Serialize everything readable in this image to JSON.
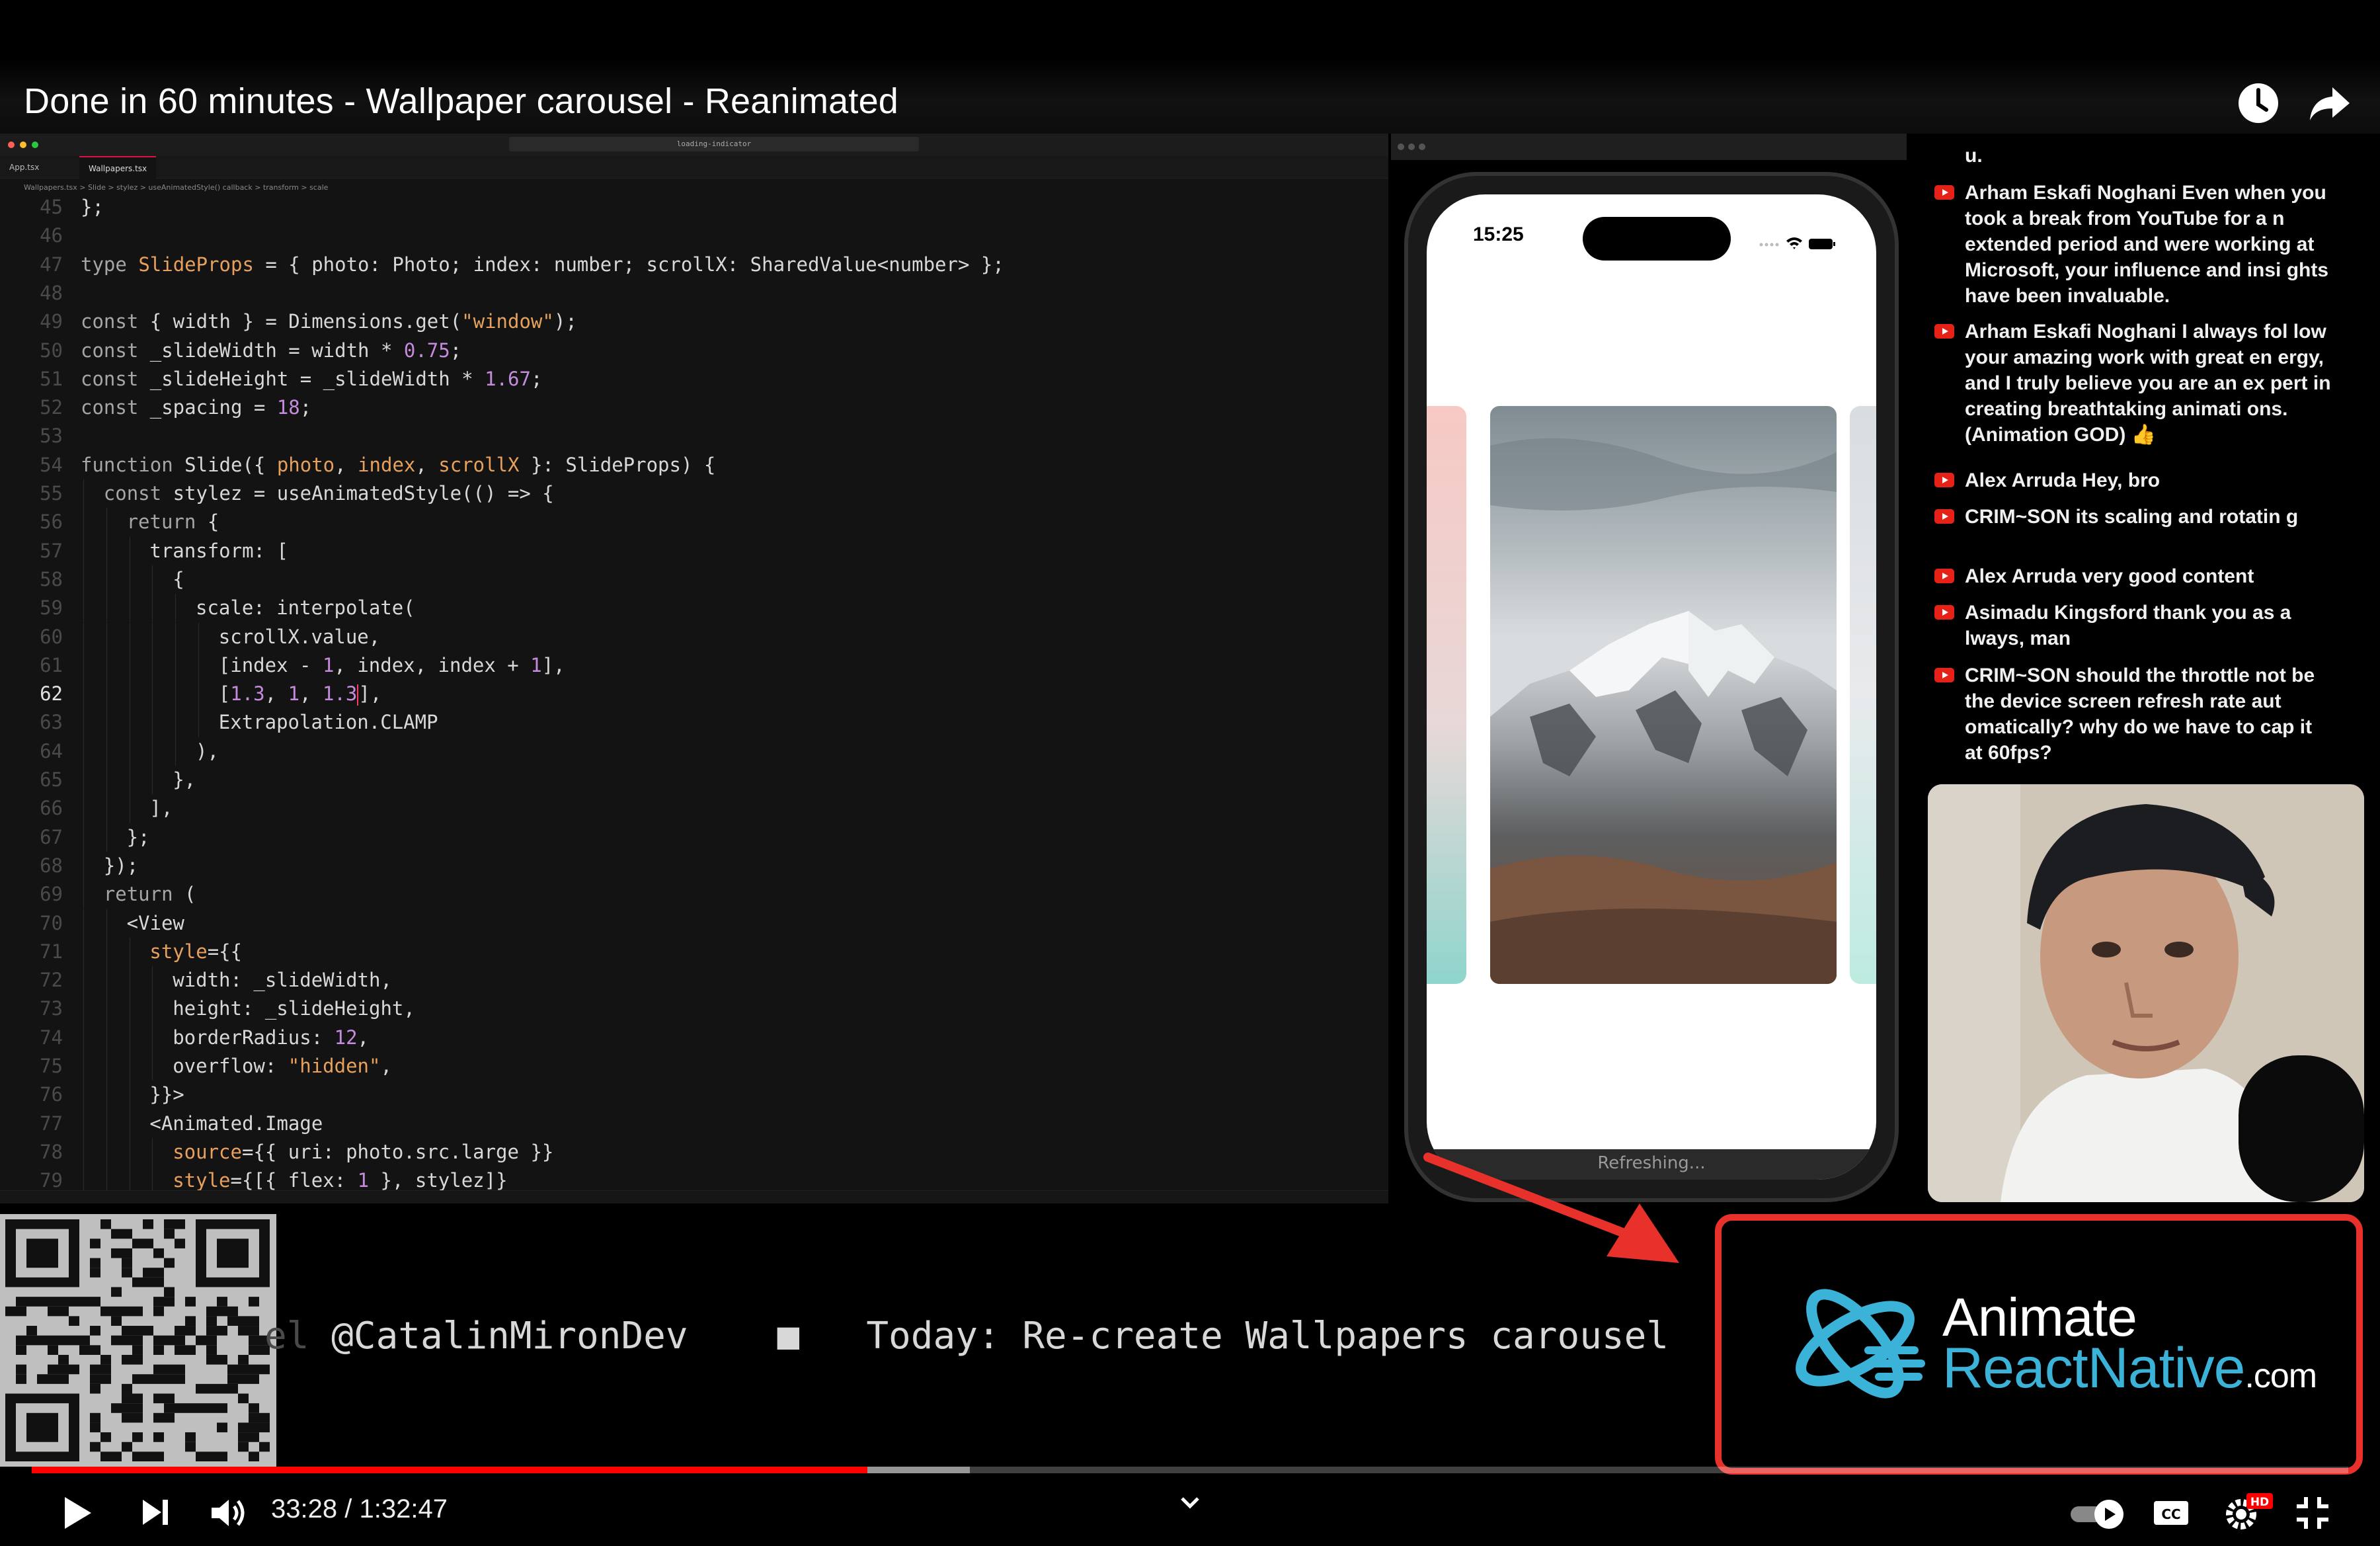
{
  "video": {
    "title": "Done in 60 minutes - Wallpaper carousel - Reanimated",
    "time_current": "33:28",
    "time_separator": "/",
    "time_total": "1:32:47",
    "progress": 0.3607,
    "buffered": 0.405,
    "hd_badge": "HD"
  },
  "editor": {
    "tabs": [
      "App.tsx",
      "Wallpapers.tsx"
    ],
    "command_center": "loading-indicator",
    "breadcrumb": "Wallpapers.tsx > Slide > stylez > useAnimatedStyle() callback > transform > scale",
    "cursor_line": 62,
    "lines": [
      {
        "num": 45,
        "indent": 0,
        "tokens": [
          [
            "p",
            "};"
          ]
        ]
      },
      {
        "num": 46,
        "indent": 0,
        "tokens": []
      },
      {
        "num": 47,
        "indent": 0,
        "tokens": [
          [
            "k",
            "type "
          ],
          [
            "t",
            "SlideProps"
          ],
          [
            "p",
            " = { photo: Photo; index: number; scrollX: SharedValue<number> };"
          ]
        ]
      },
      {
        "num": 48,
        "indent": 0,
        "tokens": []
      },
      {
        "num": 49,
        "indent": 0,
        "tokens": [
          [
            "k",
            "const "
          ],
          [
            "p",
            "{ width } = Dimensions.get("
          ],
          [
            "s",
            "\"window\""
          ],
          [
            "p",
            ");"
          ]
        ]
      },
      {
        "num": 50,
        "indent": 0,
        "tokens": [
          [
            "k",
            "const "
          ],
          [
            "p",
            "_slideWidth = width * "
          ],
          [
            "n",
            "0.75"
          ],
          [
            "p",
            ";"
          ]
        ]
      },
      {
        "num": 51,
        "indent": 0,
        "tokens": [
          [
            "k",
            "const "
          ],
          [
            "p",
            "_slideHeight = _slideWidth * "
          ],
          [
            "n",
            "1.67"
          ],
          [
            "p",
            ";"
          ]
        ]
      },
      {
        "num": 52,
        "indent": 0,
        "tokens": [
          [
            "k",
            "const "
          ],
          [
            "p",
            "_spacing = "
          ],
          [
            "n",
            "18"
          ],
          [
            "p",
            ";"
          ]
        ]
      },
      {
        "num": 53,
        "indent": 0,
        "tokens": []
      },
      {
        "num": 54,
        "indent": 0,
        "tokens": [
          [
            "k",
            "function "
          ],
          [
            "p",
            "Slide({ "
          ],
          [
            "t",
            "photo"
          ],
          [
            "p",
            ", "
          ],
          [
            "t",
            "index"
          ],
          [
            "p",
            ", "
          ],
          [
            "t",
            "scrollX"
          ],
          [
            "p",
            " }: SlideProps) {"
          ]
        ]
      },
      {
        "num": 55,
        "indent": 1,
        "tokens": [
          [
            "k",
            "const "
          ],
          [
            "p",
            "stylez = useAnimatedStyle(() => {"
          ]
        ]
      },
      {
        "num": 56,
        "indent": 2,
        "tokens": [
          [
            "k",
            "return "
          ],
          [
            "p",
            "{"
          ]
        ]
      },
      {
        "num": 57,
        "indent": 3,
        "tokens": [
          [
            "p",
            "transform: ["
          ]
        ]
      },
      {
        "num": 58,
        "indent": 4,
        "tokens": [
          [
            "p",
            "{"
          ]
        ]
      },
      {
        "num": 59,
        "indent": 5,
        "tokens": [
          [
            "p",
            "scale: interpolate("
          ]
        ]
      },
      {
        "num": 60,
        "indent": 6,
        "tokens": [
          [
            "p",
            "scrollX.value,"
          ]
        ]
      },
      {
        "num": 61,
        "indent": 6,
        "tokens": [
          [
            "p",
            "[index - "
          ],
          [
            "n",
            "1"
          ],
          [
            "p",
            ", index, index + "
          ],
          [
            "n",
            "1"
          ],
          [
            "p",
            "],"
          ]
        ]
      },
      {
        "num": 62,
        "indent": 6,
        "tokens": [
          [
            "p",
            "["
          ],
          [
            "n",
            "1.3"
          ],
          [
            "p",
            ", "
          ],
          [
            "n",
            "1"
          ],
          [
            "p",
            ", "
          ],
          [
            "n",
            "1.3"
          ],
          [
            "cursor",
            ""
          ],
          [
            "p",
            "],"
          ]
        ]
      },
      {
        "num": 63,
        "indent": 6,
        "tokens": [
          [
            "p",
            "Extrapolation.CLAMP"
          ]
        ]
      },
      {
        "num": 64,
        "indent": 5,
        "tokens": [
          [
            "p",
            "),"
          ]
        ]
      },
      {
        "num": 65,
        "indent": 4,
        "tokens": [
          [
            "p",
            "},"
          ]
        ]
      },
      {
        "num": 66,
        "indent": 3,
        "tokens": [
          [
            "p",
            "],"
          ]
        ]
      },
      {
        "num": 67,
        "indent": 2,
        "tokens": [
          [
            "p",
            "};"
          ]
        ]
      },
      {
        "num": 68,
        "indent": 1,
        "tokens": [
          [
            "p",
            "});"
          ]
        ]
      },
      {
        "num": 69,
        "indent": 1,
        "tokens": [
          [
            "k",
            "return "
          ],
          [
            "p",
            "("
          ]
        ]
      },
      {
        "num": 70,
        "indent": 2,
        "tokens": [
          [
            "p",
            "<View"
          ]
        ]
      },
      {
        "num": 71,
        "indent": 3,
        "tokens": [
          [
            "t",
            "style"
          ],
          [
            "p",
            "={{"
          ]
        ]
      },
      {
        "num": 72,
        "indent": 4,
        "tokens": [
          [
            "p",
            "width: _slideWidth,"
          ]
        ]
      },
      {
        "num": 73,
        "indent": 4,
        "tokens": [
          [
            "p",
            "height: _slideHeight,"
          ]
        ]
      },
      {
        "num": 74,
        "indent": 4,
        "tokens": [
          [
            "p",
            "borderRadius: "
          ],
          [
            "n",
            "12"
          ],
          [
            "p",
            ","
          ]
        ]
      },
      {
        "num": 75,
        "indent": 4,
        "tokens": [
          [
            "p",
            "overflow: "
          ],
          [
            "s",
            "\"hidden\""
          ],
          [
            "p",
            ","
          ]
        ]
      },
      {
        "num": 76,
        "indent": 3,
        "tokens": [
          [
            "p",
            "}}>"
          ]
        ]
      },
      {
        "num": 77,
        "indent": 3,
        "tokens": [
          [
            "p",
            "<Animated.Image"
          ]
        ]
      },
      {
        "num": 78,
        "indent": 4,
        "tokens": [
          [
            "t",
            "source"
          ],
          [
            "p",
            "={{ uri: photo.src.large }}"
          ]
        ]
      },
      {
        "num": 79,
        "indent": 4,
        "tokens": [
          [
            "t",
            "style"
          ],
          [
            "p",
            "={[{ flex: "
          ],
          [
            "n",
            "1"
          ],
          [
            "p",
            " }, stylez]}"
          ]
        ]
      }
    ]
  },
  "simulator": {
    "time": "15:25",
    "refresh_text": "Refreshing..."
  },
  "chat": {
    "partial_top": "u.",
    "messages": [
      {
        "author": "Arham Eskafi Noghani",
        "text": "Even when you took a break from YouTube for a n extended period and were working at Microsoft, your influence and insi ghts have been invaluable."
      },
      {
        "author": "Arham Eskafi Noghani",
        "text": "I always fol low your amazing work with great en ergy, and I truly believe you are an ex pert in creating breathtaking animati ons. (Animation GOD) 👍"
      },
      {
        "author": "Alex Arruda",
        "text": "Hey, bro"
      },
      {
        "author": "CRIM~SON",
        "text": "its scaling and rotatin g"
      },
      {
        "author": "Alex Arruda",
        "text": "very good content"
      },
      {
        "author": "Asimadu Kingsford",
        "text": "thank you as a lways, man"
      },
      {
        "author": "CRIM~SON",
        "text": "should the throttle not be the device screen refresh rate aut omatically? why do we have to cap it at 60fps?"
      }
    ]
  },
  "ticker": {
    "faded": "el ",
    "handle": "@CatalinMironDev",
    "bullet": "■",
    "today": "Today: Re-create Wallpapers carousel"
  },
  "logo": {
    "line1": "Animate",
    "line2": "ReactNative",
    "domain": ".com",
    "color_primary": "#3bb3d9",
    "color_border": "#e8312b"
  },
  "icons": {
    "watch_later": "clock-icon",
    "share": "share-arrow-icon",
    "play": "play-icon",
    "next": "skip-next-icon",
    "volume": "volume-icon",
    "chevron": "chevron-down-icon",
    "autoplay": "autoplay-toggle-icon",
    "captions": "cc-icon",
    "settings": "gear-icon",
    "fullscreen_exit": "exit-fullscreen-icon"
  }
}
